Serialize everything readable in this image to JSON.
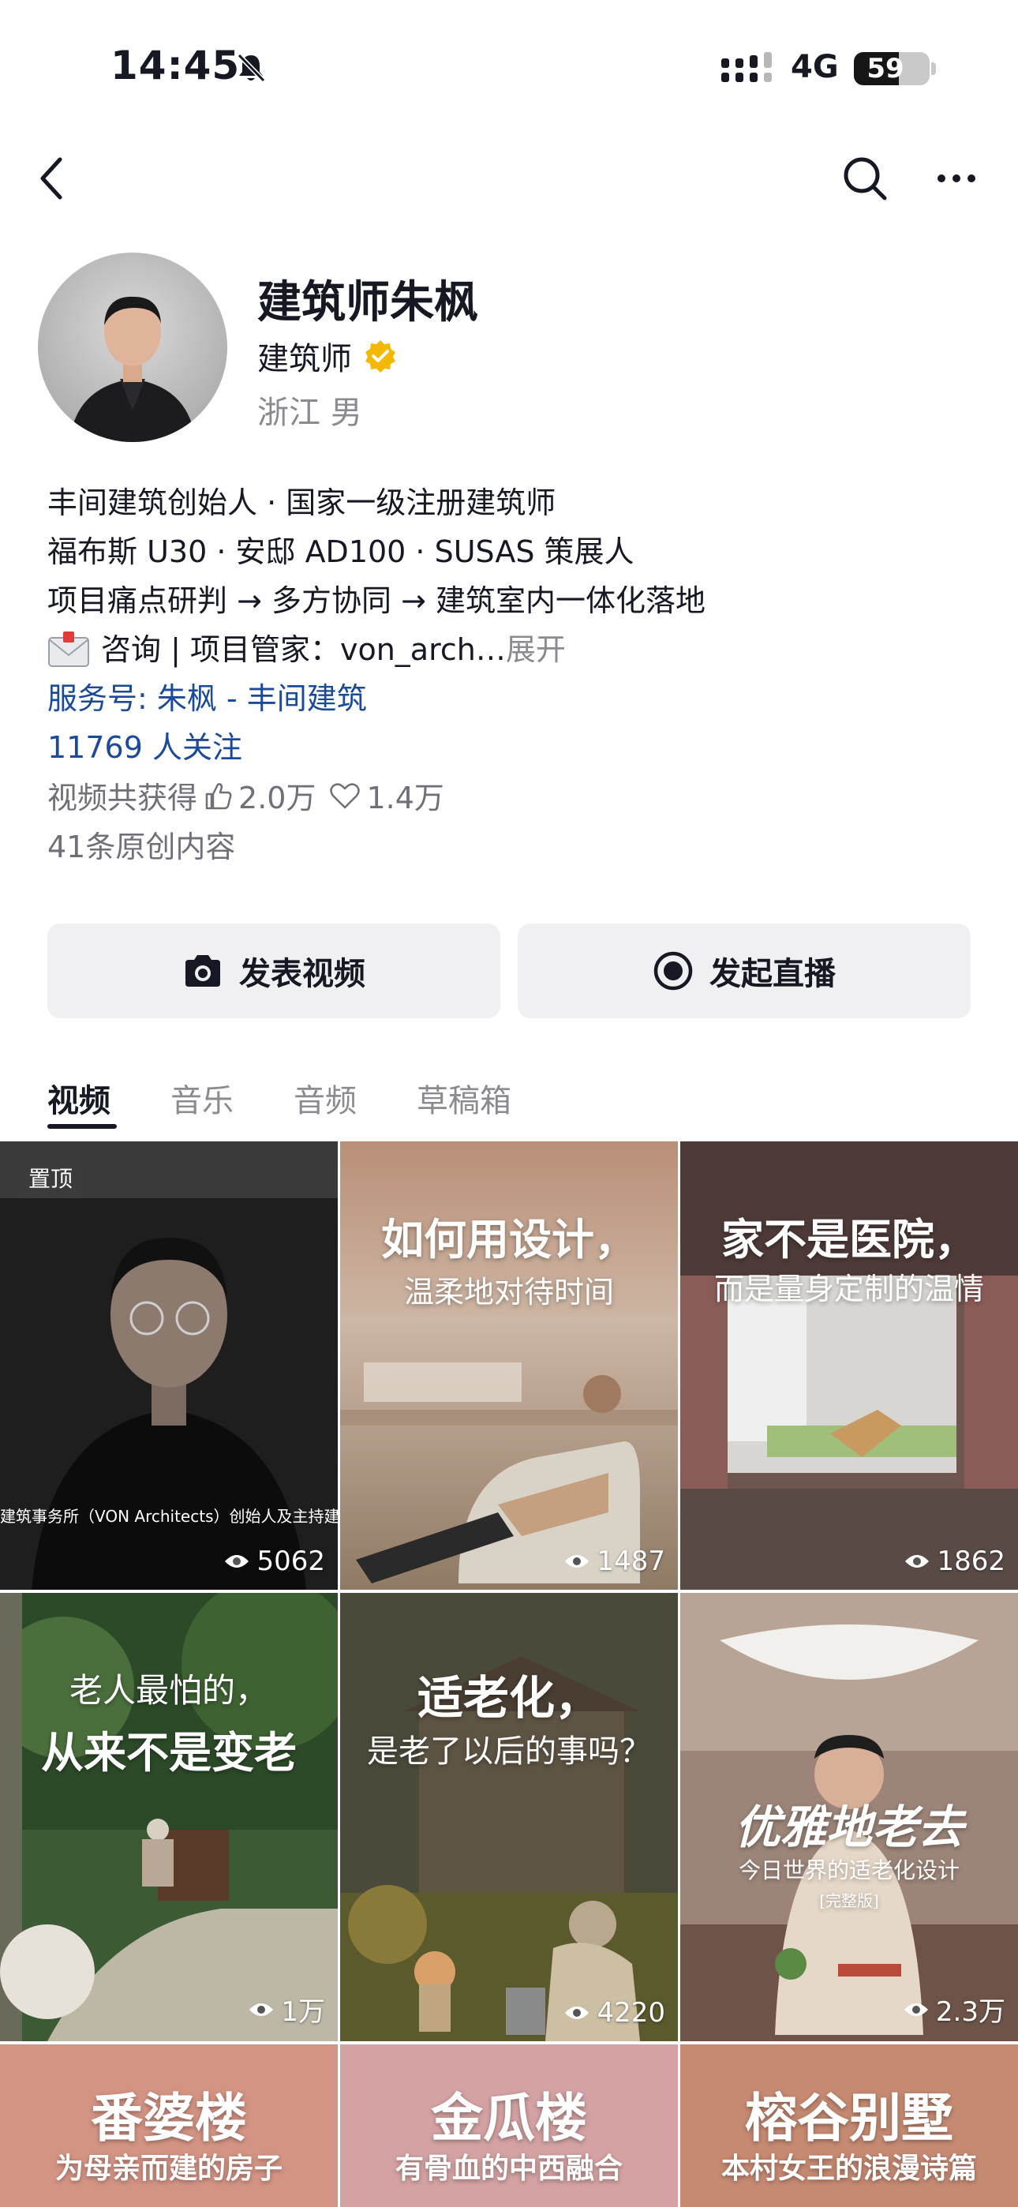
{
  "status_bar": {
    "time": "14:45",
    "network": "4G",
    "battery": "59",
    "battery_level": 0.59
  },
  "nav": {
    "back_icon": "chevron-left-icon",
    "search_icon": "search-icon",
    "more_icon": "more-dots-icon"
  },
  "profile": {
    "name": "建筑师朱枫",
    "role": "建筑师",
    "verified_color": "#f5b800",
    "location_gender": "浙江 男"
  },
  "bio": {
    "line1": "丰间建筑创始人 · 国家一级注册建筑师",
    "line2": "福布斯 U30 · 安邸 AD100 · SUSAS 策展人",
    "line3": "项目痛点研判 → 多方协同 → 建筑室内一体化落地",
    "line4": "咨询 | 项目管家：von_arch…",
    "expand": "展开"
  },
  "service": "服务号: 朱枫 - 丰间建筑",
  "followers": "11769 人关注",
  "likes": {
    "prefix": "视频共获得",
    "thumbs": "2.0万",
    "hearts": "1.4万"
  },
  "original_count": "41条原创内容",
  "actions": {
    "post_video": "发表视频",
    "go_live": "发起直播"
  },
  "tabs": [
    {
      "label": "视频",
      "active": true
    },
    {
      "label": "音乐",
      "active": false
    },
    {
      "label": "音频",
      "active": false
    },
    {
      "label": "草稿箱",
      "active": false
    }
  ],
  "videos": [
    {
      "pinned": "置顶",
      "caption": "建筑事务所（VON Architects）创始人及主持建",
      "views": "5062"
    },
    {
      "title": "如何用设计，",
      "subtitle": "温柔地对待时间",
      "views": "1487"
    },
    {
      "title": "家不是医院，",
      "subtitle": "而是量身定制的温情",
      "views": "1862"
    },
    {
      "title": "老人最怕的，",
      "subtitle": "从来不是变老",
      "views": "1万"
    },
    {
      "title": "适老化，",
      "subtitle": "是老了以后的事吗？",
      "views": "4220"
    },
    {
      "title": "优雅地老去",
      "subtitle": "今日世界的适老化设计",
      "badge": "[完整版]",
      "views": "2.3万"
    },
    {
      "title": "番婆楼",
      "subtitle": "为母亲而建的房子"
    },
    {
      "title": "金瓜楼",
      "subtitle": "有骨血的中西融合"
    },
    {
      "title": "榕谷别墅",
      "subtitle": "本村女王的浪漫诗篇"
    }
  ]
}
